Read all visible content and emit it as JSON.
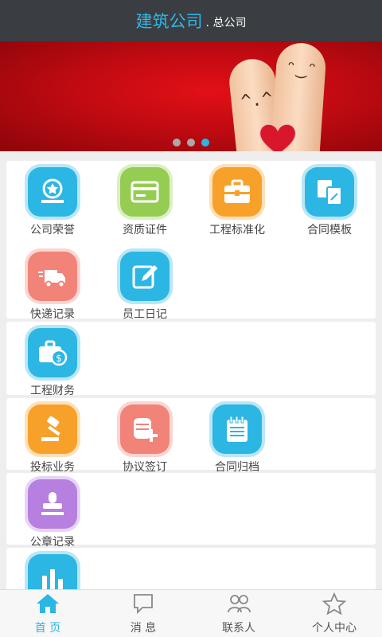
{
  "header": {
    "brand": "建筑公司",
    "suffix": ". 总公司"
  },
  "banner": {
    "slide_count": 3,
    "active_slide": 3,
    "face_left": "^.^",
    "face_right": "ᵔ‿ᵔ"
  },
  "colors": {
    "accent": "#2cb6e4",
    "header_bg": "#3a3e42",
    "banner_red": "#c10a12"
  },
  "sections": [
    {
      "items": [
        {
          "label": "公司荣誉",
          "icon": "award-icon",
          "color": "#2cb6e4"
        },
        {
          "label": "资质证件",
          "icon": "id-card-icon",
          "color": "#95cd53"
        },
        {
          "label": "工程标准化",
          "icon": "toolbox-icon",
          "color": "#f7a12b"
        },
        {
          "label": "合同模板",
          "icon": "template-icon",
          "color": "#2cb6e4"
        },
        {
          "label": "快递记录",
          "icon": "truck-icon",
          "color": "#f18379"
        },
        {
          "label": "员工日记",
          "icon": "edit-icon",
          "color": "#2cb6e4"
        }
      ]
    },
    {
      "items": [
        {
          "label": "工程财务",
          "icon": "finance-briefcase-icon",
          "color": "#2cb6e4"
        }
      ]
    },
    {
      "items": [
        {
          "label": "投标业务",
          "icon": "gavel-icon",
          "color": "#f7a12b"
        },
        {
          "label": "协议签订",
          "icon": "agreement-add-icon",
          "color": "#f18379"
        },
        {
          "label": "合同归档",
          "icon": "notepad-icon",
          "color": "#2cb6e4"
        }
      ]
    },
    {
      "items": [
        {
          "label": "公章记录",
          "icon": "stamp-icon",
          "color": "#b67fe0"
        }
      ]
    },
    {
      "items": [
        {
          "label": "",
          "icon": "bar-chart-icon",
          "color": "#2cb6e4"
        }
      ]
    }
  ],
  "tabbar": [
    {
      "label": "首 页",
      "icon": "home-icon",
      "active": true
    },
    {
      "label": "消 息",
      "icon": "message-icon",
      "active": false
    },
    {
      "label": "联系人",
      "icon": "contacts-icon",
      "active": false
    },
    {
      "label": "个人中心",
      "icon": "star-icon",
      "active": false
    }
  ]
}
